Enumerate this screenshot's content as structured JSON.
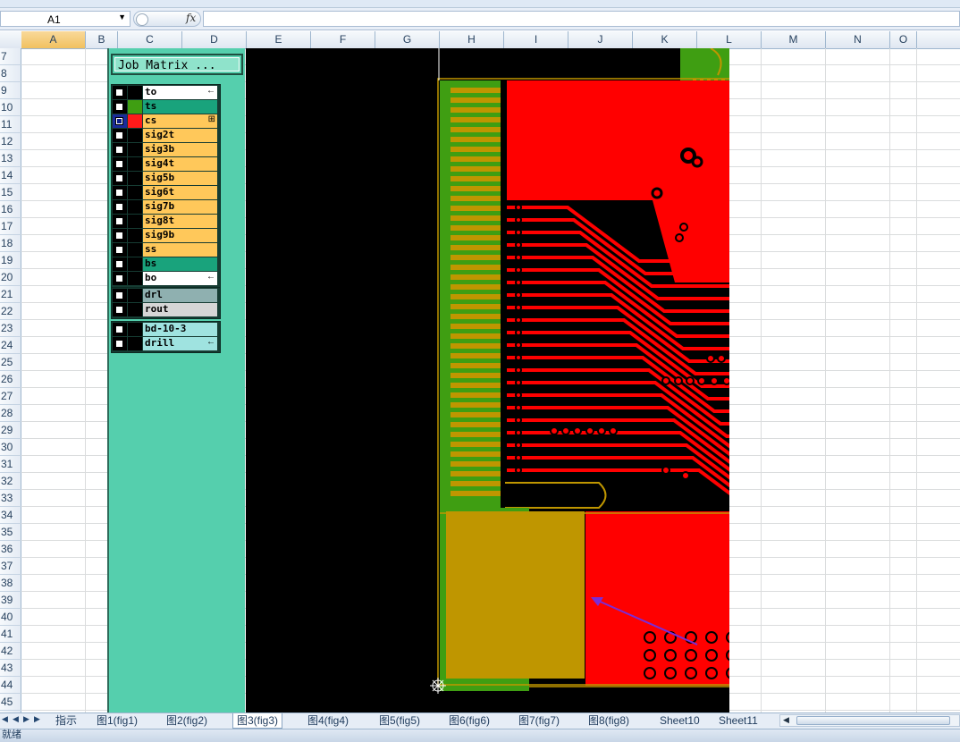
{
  "formula_bar": {
    "name_box": "A1",
    "fx_label": "fx",
    "formula": ""
  },
  "columns": [
    {
      "label": "A",
      "selected": true
    },
    {
      "label": "B"
    },
    {
      "label": "C"
    },
    {
      "label": "D"
    },
    {
      "label": "E"
    },
    {
      "label": "F"
    },
    {
      "label": "G"
    },
    {
      "label": "H"
    },
    {
      "label": "I"
    },
    {
      "label": "J"
    },
    {
      "label": "K"
    },
    {
      "label": "L"
    },
    {
      "label": "M"
    },
    {
      "label": "N"
    },
    {
      "label": "O"
    }
  ],
  "rows": [
    "7",
    "8",
    "9",
    "10",
    "11",
    "12",
    "13",
    "14",
    "15",
    "16",
    "17",
    "18",
    "19",
    "20",
    "21",
    "22",
    "23",
    "24",
    "25",
    "26",
    "27",
    "28",
    "29",
    "30",
    "31",
    "32",
    "33",
    "34",
    "35",
    "36",
    "37",
    "38",
    "39",
    "40",
    "41",
    "42",
    "43",
    "44",
    "45"
  ],
  "job_matrix": {
    "title": "Job Matrix ...",
    "groups": [
      {
        "layers": [
          {
            "name": "to",
            "color": "#ffffff",
            "swatch": "#000000",
            "checked": false,
            "flag": "←"
          },
          {
            "name": "ts",
            "color": "#19a37c",
            "swatch": "#3f9e12",
            "checked": false
          },
          {
            "name": "cs",
            "color": "#ffc85a",
            "swatch": "#ff1a1a",
            "checked": true,
            "flag": "⊞"
          },
          {
            "name": "sig2t",
            "color": "#ffc85a",
            "swatch": "#000000",
            "checked": false
          },
          {
            "name": "sig3b",
            "color": "#ffc85a",
            "swatch": "#000000",
            "checked": false
          },
          {
            "name": "sig4t",
            "color": "#ffc85a",
            "swatch": "#000000",
            "checked": false
          },
          {
            "name": "sig5b",
            "color": "#ffc85a",
            "swatch": "#000000",
            "checked": false
          },
          {
            "name": "sig6t",
            "color": "#ffc85a",
            "swatch": "#000000",
            "checked": false
          },
          {
            "name": "sig7b",
            "color": "#ffc85a",
            "swatch": "#000000",
            "checked": false
          },
          {
            "name": "sig8t",
            "color": "#ffc85a",
            "swatch": "#000000",
            "checked": false
          },
          {
            "name": "sig9b",
            "color": "#ffc85a",
            "swatch": "#000000",
            "checked": false
          },
          {
            "name": "ss",
            "color": "#ffc85a",
            "swatch": "#000000",
            "checked": false
          },
          {
            "name": "bs",
            "color": "#19a37c",
            "swatch": "#000000",
            "checked": false
          },
          {
            "name": "bo",
            "color": "#ffffff",
            "swatch": "#000000",
            "checked": false,
            "flag": "←"
          }
        ]
      },
      {
        "layers": [
          {
            "name": "drl",
            "color": "#8fb0b0",
            "swatch": "#000000",
            "checked": false
          },
          {
            "name": "rout",
            "color": "#d6d6d6",
            "swatch": "#000000",
            "checked": false
          }
        ]
      },
      {
        "layers": [
          {
            "name": "bd-10-3",
            "color": "#9fe3e0",
            "swatch": "#000000",
            "checked": false
          },
          {
            "name": "drill",
            "color": "#9fe3e0",
            "swatch": "#000000",
            "checked": false,
            "flag": "←"
          }
        ]
      }
    ]
  },
  "sheet_tabs": [
    {
      "label": "指示"
    },
    {
      "label": "图1(fig1)"
    },
    {
      "label": "图2(fig2)"
    },
    {
      "label": "图3(fig3)",
      "active": true
    },
    {
      "label": "图4(fig4)"
    },
    {
      "label": "图5(fig5)"
    },
    {
      "label": "图6(fig6)"
    },
    {
      "label": "图7(fig7)"
    },
    {
      "label": "图8(fig8)"
    },
    {
      "label": "Sheet10"
    },
    {
      "label": "Sheet11"
    }
  ],
  "status_bar": {
    "text": "就绪"
  },
  "colors": {
    "pcb_background": "#000000",
    "copper": "#ff0000",
    "soldermask_green": "#3f9e12",
    "gold_pad": "#bf9600",
    "panel_teal": "#55cfad",
    "arrow_purple": "#7a2cd8"
  }
}
